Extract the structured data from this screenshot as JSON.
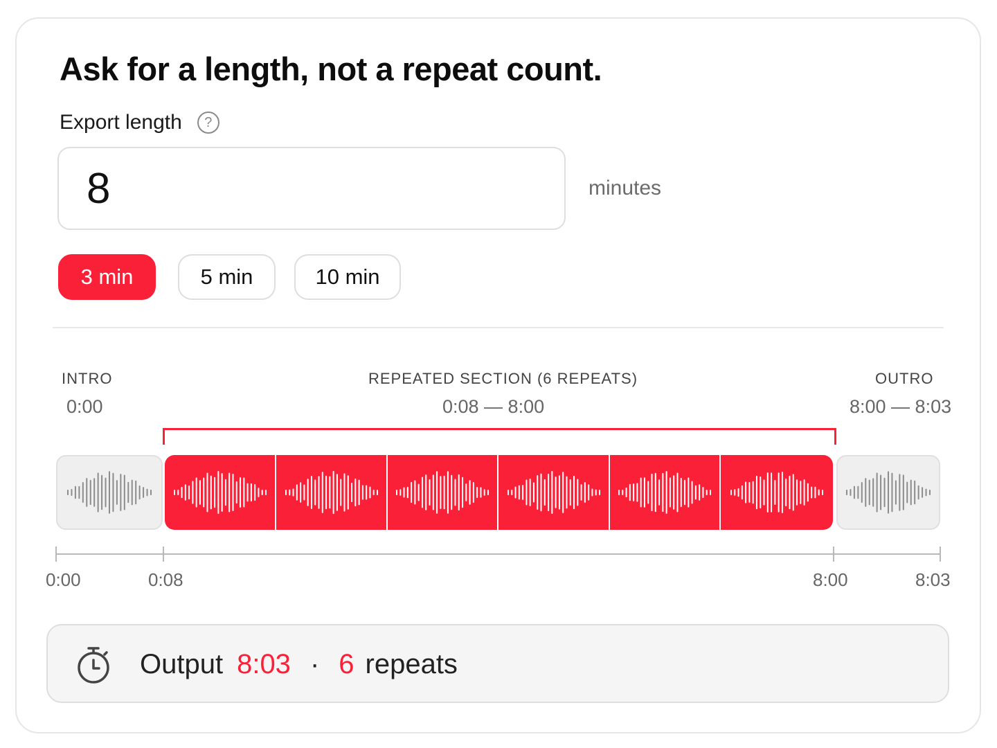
{
  "heading": "Ask for a length, not a repeat count.",
  "export": {
    "label": "Export length",
    "help_icon": "question-circle-icon",
    "value": "8",
    "unit": "minutes"
  },
  "presets": [
    {
      "label": "3 min",
      "active": true
    },
    {
      "label": "5 min",
      "active": false
    },
    {
      "label": "10 min",
      "active": false
    }
  ],
  "sections": {
    "intro": {
      "label": "INTRO",
      "time": "0:00"
    },
    "repeated": {
      "label": "REPEATED SECTION (6 REPEATS)",
      "time": "0:08 — 8:00",
      "repeats": 6
    },
    "outro": {
      "label": "OUTRO",
      "time": "8:00 — 8:03"
    }
  },
  "axis": {
    "ticks": [
      "0:00",
      "0:08",
      "8:00",
      "8:03"
    ]
  },
  "output": {
    "icon": "stopwatch-icon",
    "label": "Output",
    "duration": "8:03",
    "separator": "·",
    "repeats_count": "6",
    "repeats_label": "repeats"
  },
  "colors": {
    "accent": "#fa2038",
    "waveform_grey": "#8c8c8c",
    "block_grey": "#efefef"
  }
}
